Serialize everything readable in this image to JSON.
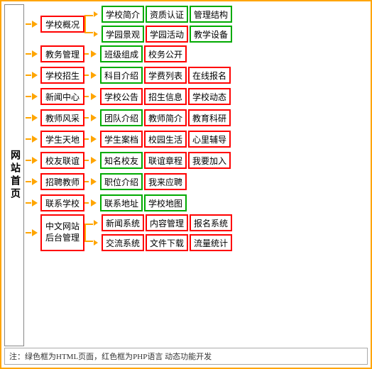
{
  "title": "网站首页",
  "left_label": "网站首页",
  "rows": [
    {
      "id": "row1",
      "l1": "学校概况",
      "branches": [
        {
          "subitems": [
            "学校简介",
            "资质认证",
            "管理结构"
          ],
          "colors": [
            "green",
            "green",
            "green"
          ]
        },
        {
          "subitems": [
            "学园景观",
            "学园活动",
            "教学设备"
          ],
          "colors": [
            "green",
            "red",
            "green"
          ]
        }
      ]
    },
    {
      "id": "row2",
      "l1": "教务管理",
      "branches": [
        {
          "subitems": [
            "班级组成",
            "校务公开"
          ],
          "colors": [
            "green",
            "red"
          ]
        }
      ]
    },
    {
      "id": "row3",
      "l1": "学校招生",
      "branches": [
        {
          "subitems": [
            "科目介绍",
            "学费列表",
            "在线报名"
          ],
          "colors": [
            "green",
            "red",
            "red"
          ]
        }
      ]
    },
    {
      "id": "row4",
      "l1": "新闻中心",
      "branches": [
        {
          "subitems": [
            "学校公告",
            "招生信息",
            "学校动态"
          ],
          "colors": [
            "red",
            "red",
            "red"
          ]
        }
      ]
    },
    {
      "id": "row5",
      "l1": "教师风采",
      "branches": [
        {
          "subitems": [
            "团队介绍",
            "教师简介",
            "教育科研"
          ],
          "colors": [
            "green",
            "red",
            "red"
          ]
        }
      ]
    },
    {
      "id": "row6",
      "l1": "学生天地",
      "branches": [
        {
          "subitems": [
            "学生案档",
            "校园生活",
            "心里辅导"
          ],
          "colors": [
            "red",
            "red",
            "red"
          ]
        }
      ]
    },
    {
      "id": "row7",
      "l1": "校友联谊",
      "branches": [
        {
          "subitems": [
            "知名校友",
            "联谊章程",
            "我要加入"
          ],
          "colors": [
            "green",
            "red",
            "red"
          ]
        }
      ]
    },
    {
      "id": "row8",
      "l1": "招聘教师",
      "branches": [
        {
          "subitems": [
            "职位介绍",
            "我来应聘"
          ],
          "colors": [
            "green",
            "red"
          ]
        }
      ]
    },
    {
      "id": "row9",
      "l1": "联系学校",
      "branches": [
        {
          "subitems": [
            "联系地址",
            "学校地图"
          ],
          "colors": [
            "green",
            "green"
          ]
        }
      ]
    },
    {
      "id": "row10",
      "l1": "中文网站\n后台管理",
      "l1_multiline": true,
      "branches": [
        {
          "subitems": [
            "新闻系统",
            "内容管理",
            "报名系统"
          ],
          "colors": [
            "red",
            "red",
            "red"
          ]
        },
        {
          "subitems": [
            "交流系统",
            "文件下载",
            "流量统计"
          ],
          "colors": [
            "red",
            "red",
            "red"
          ]
        }
      ]
    }
  ],
  "note": "注：绿色框为HTML页面，红色框为PHP语言 动态功能开发"
}
